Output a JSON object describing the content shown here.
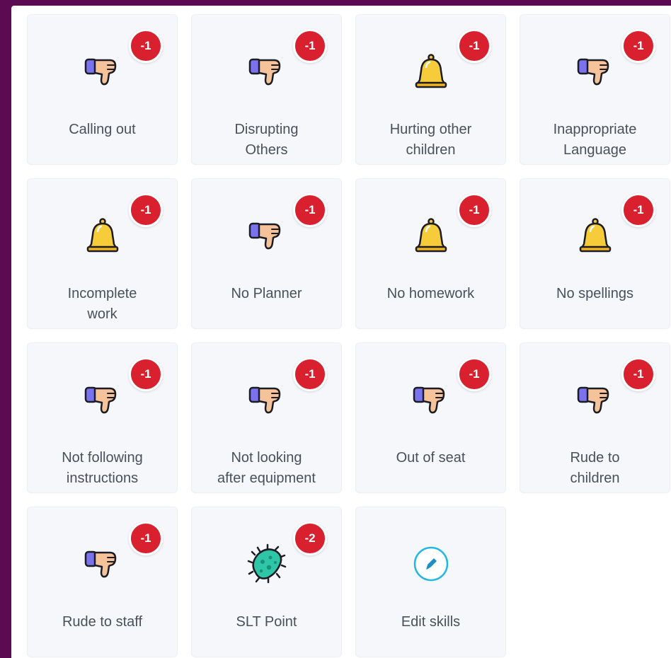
{
  "skills": [
    {
      "label": "Calling out",
      "icon": "thumbs-down-icon",
      "points": "-1"
    },
    {
      "label": "Disrupting\nOthers",
      "icon": "thumbs-down-icon",
      "points": "-1"
    },
    {
      "label": "Hurting other\nchildren",
      "icon": "bell-icon",
      "points": "-1"
    },
    {
      "label": "Inappropriate\nLanguage",
      "icon": "thumbs-down-icon",
      "points": "-1"
    },
    {
      "label": "Incomplete\nwork",
      "icon": "bell-icon",
      "points": "-1"
    },
    {
      "label": "No Planner",
      "icon": "thumbs-down-icon",
      "points": "-1"
    },
    {
      "label": "No homework",
      "icon": "bell-icon",
      "points": "-1"
    },
    {
      "label": "No spellings",
      "icon": "bell-icon",
      "points": "-1"
    },
    {
      "label": "Not following\ninstructions",
      "icon": "thumbs-down-icon",
      "points": "-1"
    },
    {
      "label": "Not looking\nafter equipment",
      "icon": "thumbs-down-icon",
      "points": "-1"
    },
    {
      "label": "Out of seat",
      "icon": "thumbs-down-icon",
      "points": "-1"
    },
    {
      "label": "Rude to\nchildren",
      "icon": "thumbs-down-icon",
      "points": "-1"
    },
    {
      "label": "Rude to staff",
      "icon": "thumbs-down-icon",
      "points": "-1"
    },
    {
      "label": "SLT Point",
      "icon": "germ-icon",
      "points": "-2"
    }
  ],
  "edit": {
    "label": "Edit skills",
    "icon": "pencil-icon"
  },
  "colors": {
    "background": "#5c0a52",
    "tile": "#f6f7fa",
    "badge": "#d8202e",
    "edit_accent": "#22b7e6"
  }
}
